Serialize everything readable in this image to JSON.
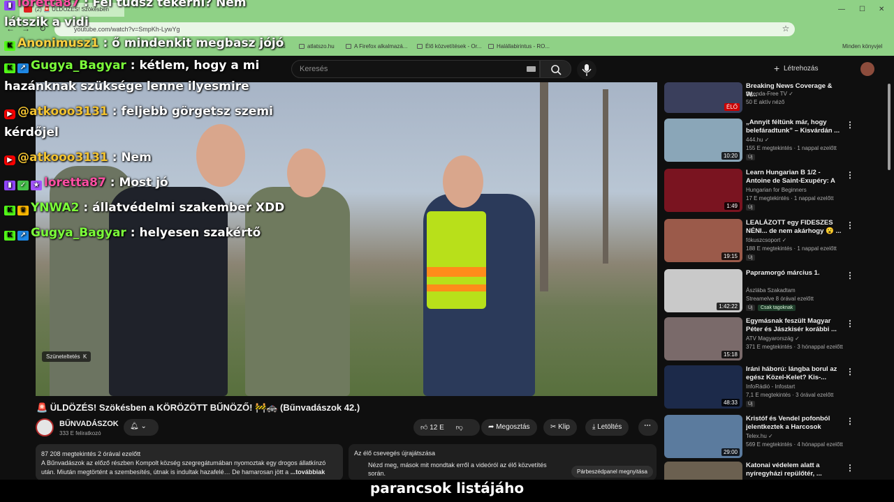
{
  "browser": {
    "tab_title": "(2) 🚨 ÜLDÖZÉS! Szökésben",
    "url": "youtube.com/watch?v=SmpKh-LywYg",
    "bookmarks": [
      "atlatszo.hu",
      "atlatszo.hu",
      "A Firefox alkalmazá...",
      "Élő közvetítések - Or...",
      "Halállabirintus - RO..."
    ],
    "other_bookmarks": "Minden könyvjel"
  },
  "youtube": {
    "search_placeholder": "Keresés",
    "create_label": "Létrehozás"
  },
  "chat_overlay": [
    {
      "badges": [
        "twitch"
      ],
      "user": "loretta87",
      "user_color": "#ff4fa3",
      "message": "Fel tudsz tekerni? Nem",
      "wrap": "látszik a vidi"
    },
    {
      "badges": [
        "kick"
      ],
      "user": "Anonimusz1",
      "user_color": "#ffd23f",
      "message": "ő mindenkit megbasz jójó",
      "wrap": ""
    },
    {
      "badges": [
        "kick",
        "blue"
      ],
      "user": "Gugya_Bagyar",
      "user_color": "#7cff3a",
      "message": "kétlem, hogy a mi",
      "wrap": "hazánknak szüksége lenne ilyesmire"
    },
    {
      "badges": [
        "yt"
      ],
      "user": "@atkooo3131",
      "user_color": "#f2c230",
      "message": "feljebb görgetsz szemi",
      "wrap": "kérdőjel"
    },
    {
      "badges": [
        "yt"
      ],
      "user": "@atkooo3131",
      "user_color": "#f2c230",
      "message": "Nem",
      "wrap": ""
    },
    {
      "badges": [
        "twitch",
        "green",
        "purple"
      ],
      "user": "loretta87",
      "user_color": "#ff4fa3",
      "message": "Most jó",
      "wrap": ""
    },
    {
      "badges": [
        "kick",
        "crown"
      ],
      "user": "YNWA2",
      "user_color": "#7cff3a",
      "message": "állatvédelmi szakember XDD",
      "wrap": ""
    },
    {
      "badges": [
        "kick",
        "blue"
      ],
      "user": "Gugya_Bagyar",
      "user_color": "#7cff3a",
      "message": "helyesen szakértő",
      "wrap": ""
    }
  ],
  "video": {
    "pause_label": "Szüneteltetés",
    "pause_key": "K"
  },
  "main": {
    "title": "🚨 ÜLDÖZÉS! Szökésben a KÖRÖZÖTT BŰNÖZŐ! 🚧🚓 (Bűnvadászok 42.)",
    "channel_name": "BŰNVADÁSZOK",
    "channel_subs": "333 E feliratkozó",
    "likes": "12 E",
    "share_label": "Megosztás",
    "clip_label": "Klip",
    "download_label": "Letöltés",
    "desc_stats": "87 208 megtekintés  2 órával ezelőtt",
    "desc_text": "A Bűnvadászok az előző részben Kompolt község szegregátumában nyomoztak egy drogos állatkínzó után. Miután megtörtént a szembesítés, útnak is indultak hazafelé… De hamarosan jött a",
    "desc_more": "...továbbiak",
    "replay_title": "Az élő csevegés újrajátszása",
    "replay_text": "Nézd meg, mások mit mondtak erről a videóról az élő közvetítés során.",
    "replay_open": "Párbeszédpanel megnyitása"
  },
  "sidebar": [
    {
      "title": "Breaking News Coverage & W...",
      "meta1": "Agenda-Free TV ✓",
      "meta2": "50 E aktív néző",
      "duration": "ÉLŐ",
      "badge": "",
      "color": "#3a3f5c"
    },
    {
      "title": "„Annyit féltünk már, hogy belefáradtunk” – Kisvárdán ...",
      "meta1": "444.hu ✓",
      "meta2": "155 E megtekintés · 1 nappal ezelőtt",
      "duration": "10:20",
      "badge": "Új",
      "color": "#8aa6b8"
    },
    {
      "title": "Learn Hungarian B 1/2 - Antoine de Saint-Exupéry: A ki...",
      "meta1": "Hungarian for Beginners",
      "meta2": "17 E megtekintés · 1 nappal ezelőtt",
      "duration": "1:49",
      "badge": "Új",
      "color": "#7a1420"
    },
    {
      "title": "LEALÁZOTT egy FIDESZES NÉNI... de nem akárhogy 😮 ...",
      "meta1": "fókuszcsoport ✓",
      "meta2": "188 E megtekintés · 1 nappal ezelőtt",
      "duration": "19:15",
      "badge": "Új",
      "color": "#9b5a4a"
    },
    {
      "title": "Papramorgó március 1.",
      "meta1": "Ászlába Szakadtam",
      "meta2": "Streamelve 8 órával ezelőtt",
      "duration": "1:42:22",
      "badge": "Új",
      "members": "Csak tagoknak",
      "color": "#c9c9c9"
    },
    {
      "title": "Egymásnak feszült Magyar Péter és Jászkisér korábbi ...",
      "meta1": "ATV Magyarország ✓",
      "meta2": "371 E megtekintés · 3 hónappal ezelőtt",
      "duration": "15:18",
      "badge": "",
      "color": "#7a6a6a"
    },
    {
      "title": "Iráni háború: lángba borul az egész Közel-Kelet? Kis-...",
      "meta1": "InfoRádió - Infostart",
      "meta2": "7,1 E megtekintés · 3 órával ezelőtt",
      "duration": "48:33",
      "badge": "Új",
      "color": "#1c2a4a"
    },
    {
      "title": "Kristóf és Vendel pofonból jelentkeztek a Harcosok Klubj...",
      "meta1": "Telex.hu ✓",
      "meta2": "569 E megtekintés · 4 hónappal ezelőtt",
      "duration": "29:00",
      "badge": "",
      "color": "#5b7b9e"
    },
    {
      "title": "Katonai védelem alatt a nyíregyházi repülőtér, ...",
      "meta1": "",
      "meta2": "",
      "duration": "",
      "badge": "",
      "color": "#6b6050"
    }
  ],
  "caption": "parancsok listájáho",
  "colors": {
    "chrome": "#8fd186",
    "yt_bg": "#0f0f0f",
    "accent_red": "#ff0000"
  }
}
